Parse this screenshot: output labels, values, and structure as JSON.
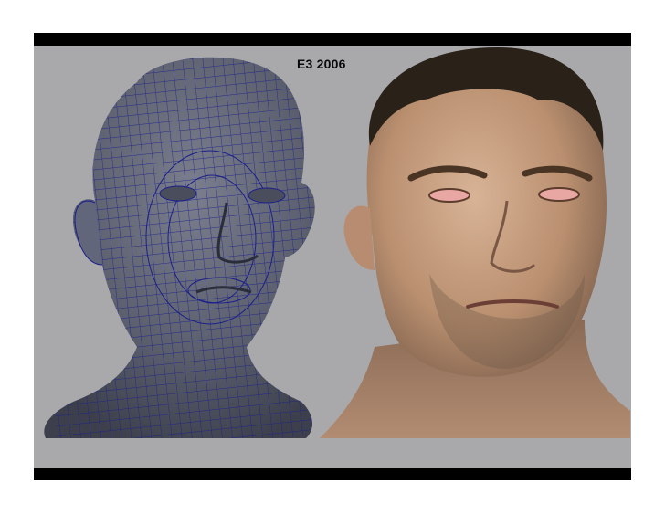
{
  "slide": {
    "caption": "E3 2006",
    "background_color": "#a9a9ac",
    "frame_color": "#000000"
  },
  "images": {
    "left": {
      "name": "wireframe-head-render",
      "mesh_color": "#5e6170",
      "wire_color": "#1b1f8a"
    },
    "right": {
      "name": "textured-head-render",
      "skin_color": "#c39a7c",
      "hair_color": "#2a2119"
    }
  }
}
